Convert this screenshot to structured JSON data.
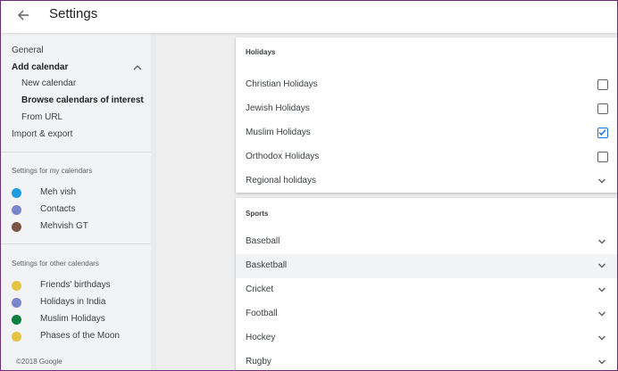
{
  "header": {
    "title": "Settings"
  },
  "sidebar": {
    "nav": [
      {
        "label": "General"
      },
      {
        "label": "Add calendar"
      },
      {
        "label": "New calendar"
      },
      {
        "label": "Browse calendars of interest"
      },
      {
        "label": "From URL"
      },
      {
        "label": "Import & export"
      }
    ],
    "my_calendars_label": "Settings for my calendars",
    "my_calendars": [
      {
        "label": "Meh vish",
        "color": "#1e9ce0"
      },
      {
        "label": "Contacts",
        "color": "#7986cb"
      },
      {
        "label": "Mehvish GT",
        "color": "#795548"
      }
    ],
    "other_calendars_label": "Settings for other calendars",
    "other_calendars": [
      {
        "label": "Friends' birthdays",
        "color": "#e4c441"
      },
      {
        "label": "Holidays in India",
        "color": "#7986cb"
      },
      {
        "label": "Muslim Holidays",
        "color": "#0b8043"
      },
      {
        "label": "Phases of the Moon",
        "color": "#e4c441"
      }
    ],
    "footer": "©2018 Google"
  },
  "holidays": {
    "title": "Holidays",
    "items": [
      {
        "label": "Christian Holidays",
        "checked": false
      },
      {
        "label": "Jewish Holidays",
        "checked": false
      },
      {
        "label": "Muslim Holidays",
        "checked": true
      },
      {
        "label": "Orthodox Holidays",
        "checked": false
      }
    ],
    "regional": "Regional holidays"
  },
  "sports": {
    "title": "Sports",
    "items": [
      {
        "label": "Baseball"
      },
      {
        "label": "Basketball"
      },
      {
        "label": "Cricket"
      },
      {
        "label": "Football"
      },
      {
        "label": "Hockey"
      },
      {
        "label": "Rugby"
      }
    ]
  },
  "colors": {
    "accent": "#1a73e8",
    "border": "#6a2f76"
  }
}
